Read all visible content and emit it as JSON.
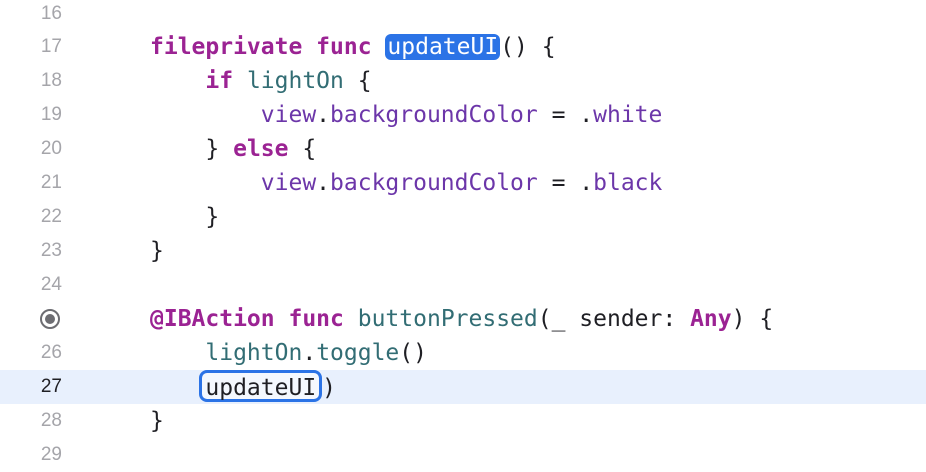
{
  "editor": {
    "lines": [
      {
        "num": "16",
        "tokens": []
      },
      {
        "num": "17",
        "tokens": [
          {
            "t": "fileprivate func ",
            "c": "kw"
          },
          {
            "t": "updateUI",
            "c": "sel"
          },
          {
            "t": "() {",
            "c": "plain"
          }
        ]
      },
      {
        "num": "18",
        "tokens": [
          {
            "t": "    if ",
            "c": "kw"
          },
          {
            "t": "lightOn",
            "c": "ident"
          },
          {
            "t": " {",
            "c": "plain"
          }
        ]
      },
      {
        "num": "19",
        "tokens": [
          {
            "t": "        view",
            "c": "prop"
          },
          {
            "t": ".",
            "c": "plain"
          },
          {
            "t": "backgroundColor",
            "c": "prop"
          },
          {
            "t": " = .",
            "c": "plain"
          },
          {
            "t": "white",
            "c": "prop"
          }
        ]
      },
      {
        "num": "20",
        "tokens": [
          {
            "t": "    } ",
            "c": "plain"
          },
          {
            "t": "else",
            "c": "kw"
          },
          {
            "t": " {",
            "c": "plain"
          }
        ]
      },
      {
        "num": "21",
        "tokens": [
          {
            "t": "        view",
            "c": "prop"
          },
          {
            "t": ".",
            "c": "plain"
          },
          {
            "t": "backgroundColor",
            "c": "prop"
          },
          {
            "t": " = .",
            "c": "plain"
          },
          {
            "t": "black",
            "c": "prop"
          }
        ]
      },
      {
        "num": "22",
        "tokens": [
          {
            "t": "    }",
            "c": "plain"
          }
        ]
      },
      {
        "num": "23",
        "tokens": [
          {
            "t": "}",
            "c": "plain"
          }
        ]
      },
      {
        "num": "24",
        "tokens": []
      },
      {
        "num": "",
        "breakpoint": true,
        "tokens": [
          {
            "t": "@IBAction",
            "c": "kw"
          },
          {
            "t": " ",
            "c": "plain"
          },
          {
            "t": "func",
            "c": "kw"
          },
          {
            "t": " ",
            "c": "plain"
          },
          {
            "t": "buttonPressed",
            "c": "ident"
          },
          {
            "t": "(_ sender: ",
            "c": "plain"
          },
          {
            "t": "Any",
            "c": "kw"
          },
          {
            "t": ") {",
            "c": "plain"
          }
        ]
      },
      {
        "num": "26",
        "tokens": [
          {
            "t": "    lightOn",
            "c": "ident"
          },
          {
            "t": ".",
            "c": "plain"
          },
          {
            "t": "toggle",
            "c": "ident"
          },
          {
            "t": "()",
            "c": "plain"
          }
        ]
      },
      {
        "num": "27",
        "current": true,
        "tokens": [
          {
            "t": "    ",
            "c": "plain"
          },
          {
            "t": "updateUI",
            "c": "found"
          },
          {
            "t": ")",
            "c": "plain"
          }
        ]
      },
      {
        "num": "28",
        "tokens": [
          {
            "t": "}",
            "c": "plain"
          }
        ]
      },
      {
        "num": "29",
        "tokens": []
      }
    ]
  },
  "colors": {
    "keyword": "#9b2393",
    "property": "#6c36a9",
    "identifier": "#326d74",
    "selection": "#2b73e6",
    "current_line": "#e8f0fd",
    "gutter_text": "#a5a5aa"
  },
  "icons": {
    "breakpoint": "breakpoint-icon"
  }
}
